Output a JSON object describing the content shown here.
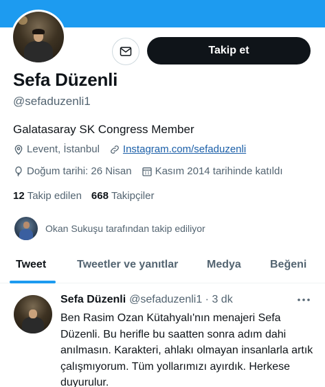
{
  "profile": {
    "name": "Sefa Düzenli",
    "handle": "@sefaduzenli1",
    "bio": "Galatasaray SK Congress Member",
    "location": "Levent, İstanbul",
    "website": "Instagram.com/sefaduzenli",
    "birthday": "Doğum tarihi: 26 Nisan",
    "joined": "Kasım 2014 tarihinde katıldı",
    "following_count": "12",
    "following_label": "Takip edilen",
    "followers_count": "668",
    "followers_label": "Takipçiler",
    "followed_by": "Okan Sukuşu tarafından takip ediliyor"
  },
  "actions": {
    "follow_label": "Takip et",
    "message_icon": "envelope-icon"
  },
  "tabs": [
    {
      "label": "Tweet",
      "active": true
    },
    {
      "label": "Tweetler ve yanıtlar",
      "active": false
    },
    {
      "label": "Medya",
      "active": false
    },
    {
      "label": "Beğeni",
      "active": false
    }
  ],
  "tweet": {
    "name": "Sefa Düzenli",
    "meta": "@sefaduzenli1 · 3 dk",
    "text": "Ben Rasim Ozan Kütahyalı'nın menajeri Sefa Düzenli. Bu herifle bu saatten sonra adım dahi anılmasın. Karakteri, ahlakı olmayan insanlarla artık çalışmıyorum. Tüm yollarımızı ayırdık. Herkese duyurulur."
  },
  "colors": {
    "accent": "#1d9bf0",
    "text": "#0f1419",
    "secondary": "#536471",
    "link": "#1b5fa8"
  }
}
